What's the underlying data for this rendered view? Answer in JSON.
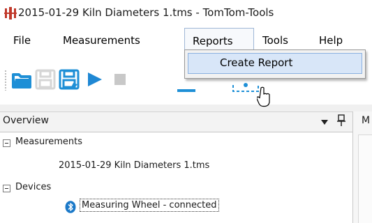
{
  "window": {
    "title": "2015-01-29 Kiln Diameters 1.tms - TomTom-Tools",
    "app_icon": "app-columns-icon"
  },
  "menu": {
    "file": "File",
    "measurements": "Measurements",
    "reports": "Reports",
    "tools": "Tools",
    "help": "Help",
    "active": "Reports"
  },
  "toolbar": {
    "icons": [
      "open-folder-icon",
      "save-icon",
      "save-as-icon",
      "play-icon",
      "stop-icon"
    ]
  },
  "reports_dropdown": {
    "items": [
      {
        "label": "Create Report",
        "highlighted": true
      }
    ]
  },
  "overview": {
    "title": "Overview",
    "tree": {
      "measurements_label": "Measurements",
      "measurements_file": "2015-01-29 Kiln Diameters 1.tms",
      "devices_label": "Devices",
      "device": "Measuring Wheel - connected",
      "device_icon": "bluetooth-icon"
    }
  },
  "right_panel": {
    "label": "M"
  },
  "colors": {
    "accent_blue": "#1e8fd6",
    "play_blue": "#1f88d4",
    "menu_highlight": "#d8e6f8",
    "bluetooth_blue": "#1b79c8"
  }
}
